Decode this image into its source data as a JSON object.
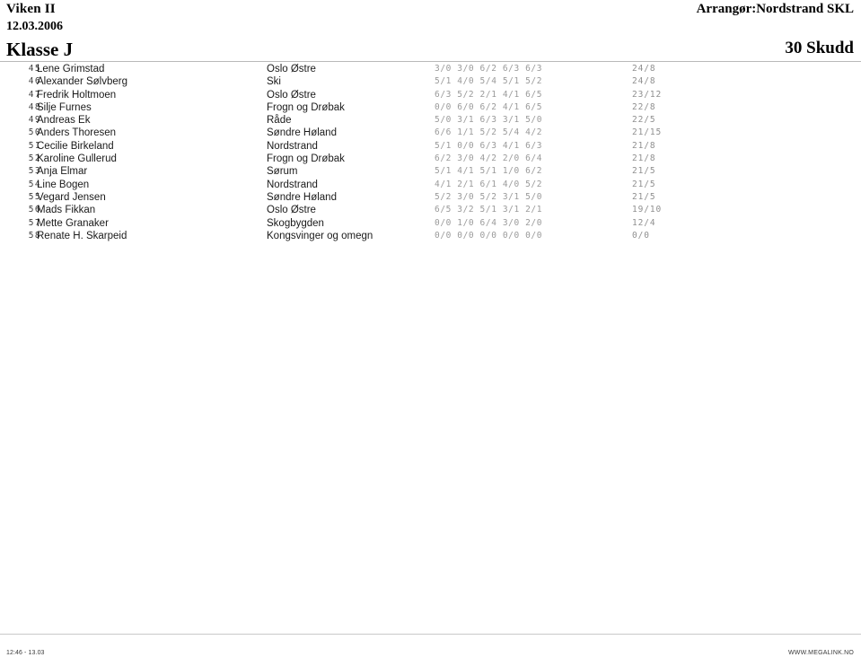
{
  "header": {
    "event_title": "Viken II",
    "event_date": "12.03.2006",
    "class_title": "Klasse J",
    "organizer": "Arrangør:Nordstrand SKL",
    "discipline": "30 Skudd"
  },
  "footer": {
    "time_range": "12:46 - 13.03",
    "website": "WWW.MEGALINK.NO"
  },
  "results": [
    {
      "rank": "45",
      "name": "Lene Grimstad",
      "club": "Oslo Østre",
      "series": "3/0 3/0 6/2 6/3 6/3",
      "total": "24/8"
    },
    {
      "rank": "46",
      "name": "Alexander Sølvberg",
      "club": "Ski",
      "series": "5/1 4/0 5/4 5/1 5/2",
      "total": "24/8"
    },
    {
      "rank": "47",
      "name": "Fredrik Holtmoen",
      "club": "Oslo Østre",
      "series": "6/3 5/2 2/1 4/1 6/5",
      "total": "23/12"
    },
    {
      "rank": "48",
      "name": "Silje Furnes",
      "club": "Frogn og Drøbak",
      "series": "0/0 6/0 6/2 4/1 6/5",
      "total": "22/8"
    },
    {
      "rank": "49",
      "name": "Andreas Ek",
      "club": "Råde",
      "series": "5/0 3/1 6/3 3/1 5/0",
      "total": "22/5"
    },
    {
      "rank": "50",
      "name": "Anders Thoresen",
      "club": "Søndre Høland",
      "series": "6/6 1/1 5/2 5/4 4/2",
      "total": "21/15"
    },
    {
      "rank": "51",
      "name": "Cecilie Birkeland",
      "club": "Nordstrand",
      "series": "5/1 0/0 6/3 4/1 6/3",
      "total": "21/8"
    },
    {
      "rank": "52",
      "name": "Karoline Gullerud",
      "club": "Frogn og Drøbak",
      "series": "6/2 3/0 4/2 2/0 6/4",
      "total": "21/8"
    },
    {
      "rank": "53",
      "name": "Anja Elmar",
      "club": "Sørum",
      "series": "5/1 4/1 5/1 1/0 6/2",
      "total": "21/5"
    },
    {
      "rank": "54",
      "name": "Line Bogen",
      "club": "Nordstrand",
      "series": "4/1 2/1 6/1 4/0 5/2",
      "total": "21/5"
    },
    {
      "rank": "55",
      "name": "Vegard Jensen",
      "club": "Søndre Høland",
      "series": "5/2 3/0 5/2 3/1 5/0",
      "total": "21/5"
    },
    {
      "rank": "56",
      "name": "Mads Fikkan",
      "club": "Oslo Østre",
      "series": "6/5 3/2 5/1 3/1 2/1",
      "total": "19/10"
    },
    {
      "rank": "57",
      "name": "Mette Granaker",
      "club": "Skogbygden",
      "series": "0/0 1/0 6/4 3/0 2/0",
      "total": "12/4"
    },
    {
      "rank": "58",
      "name": "Renate H. Skarpeid",
      "club": "Kongsvinger og omegn",
      "series": "0/0 0/0 0/0 0/0 0/0",
      "total": "0/0"
    }
  ]
}
